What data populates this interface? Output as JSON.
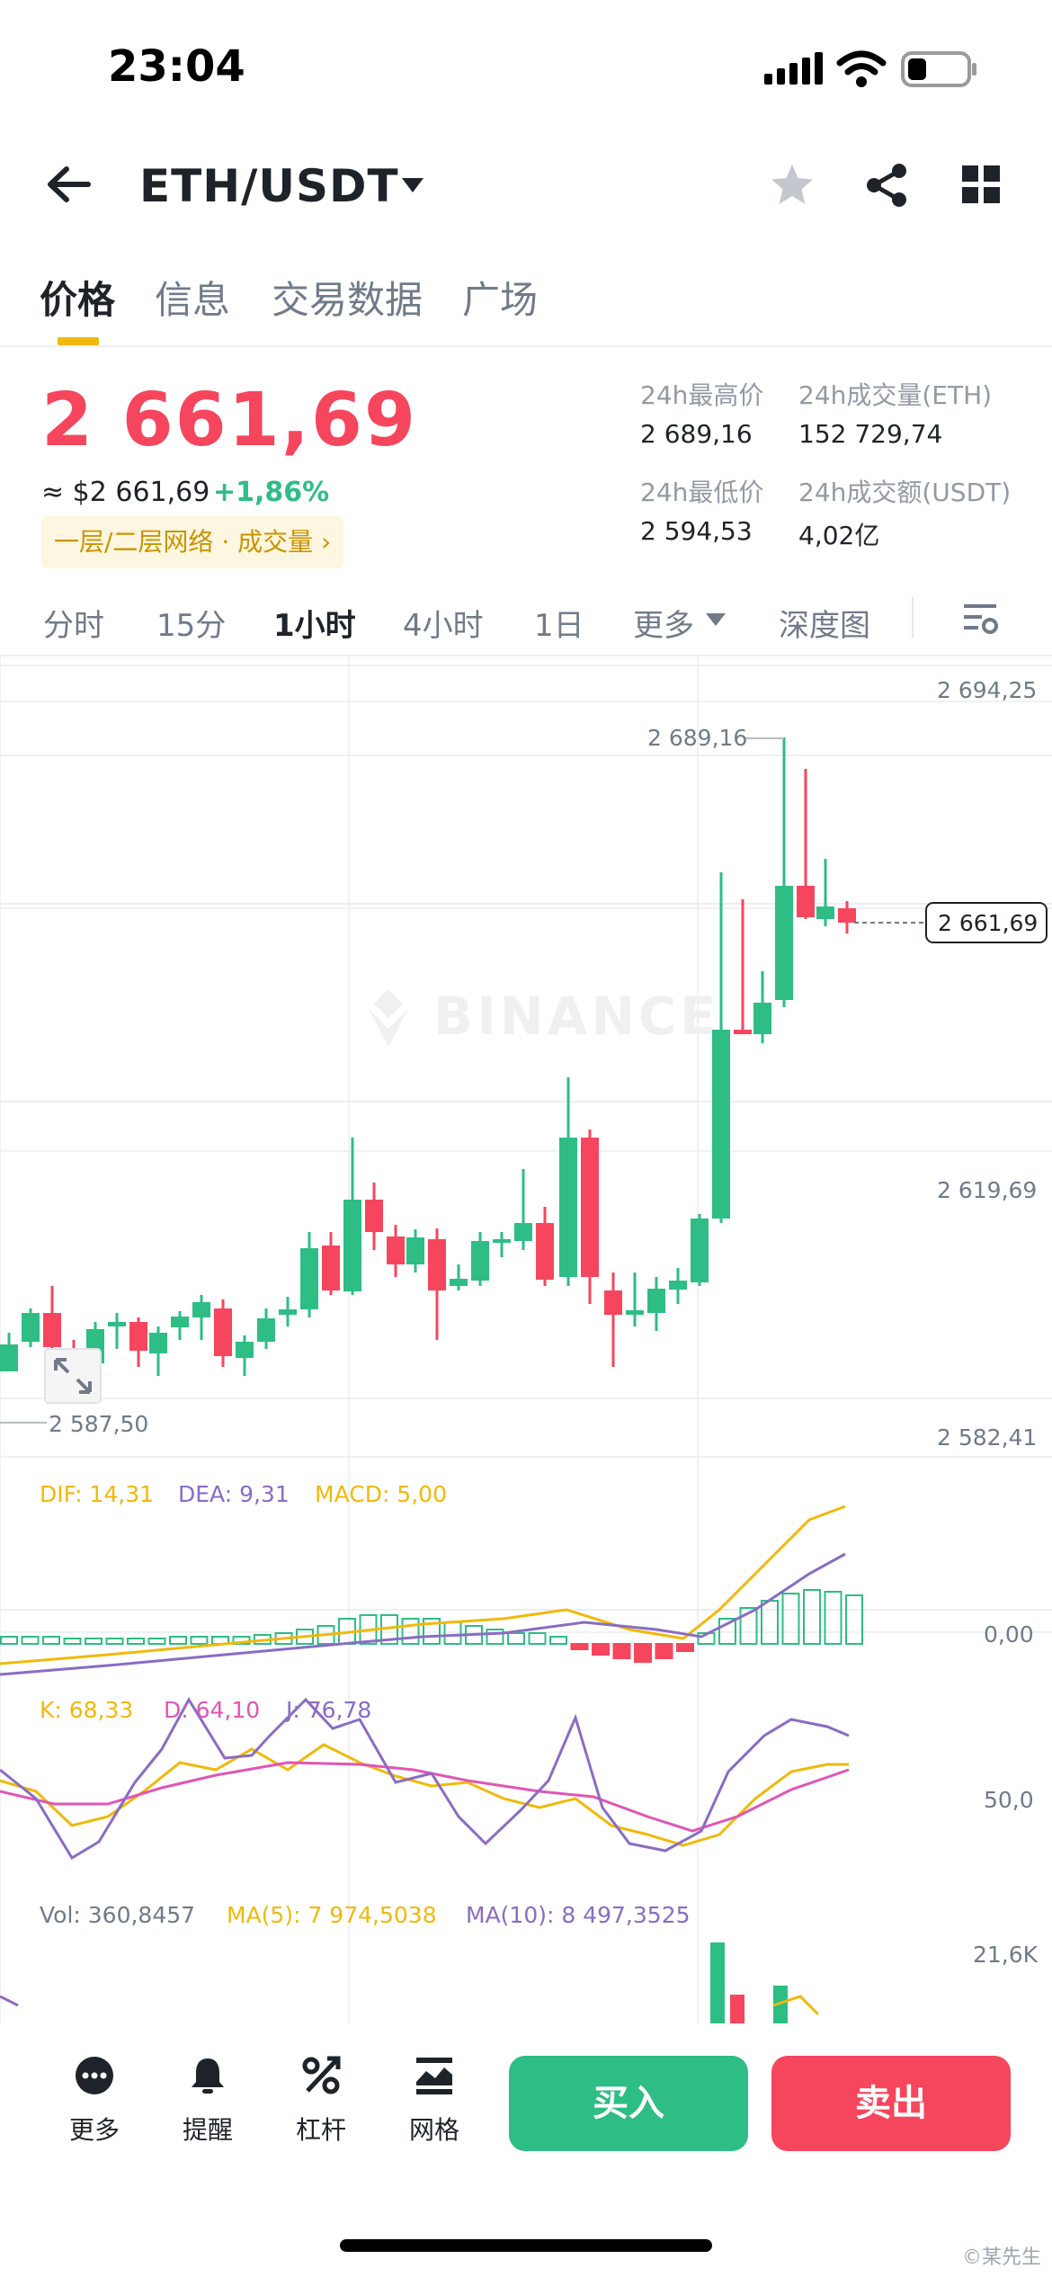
{
  "status_bar": {
    "time": "23:04"
  },
  "header": {
    "pair": "ETH/USDT"
  },
  "tabs": [
    {
      "label": "价格"
    },
    {
      "label": "信息"
    },
    {
      "label": "交易数据"
    },
    {
      "label": "广场"
    }
  ],
  "price": {
    "last": "2 661,69",
    "approx": "≈ $2 661,69",
    "change": "+1,86%",
    "chip": "一层/二层网络 · 成交量 ›"
  },
  "stats": {
    "high_label": "24h最高价",
    "high": "2 689,16",
    "vol_eth_label": "24h成交量(ETH)",
    "vol_eth": "152 729,74",
    "low_label": "24h最低价",
    "low": "2 594,53",
    "vol_usdt_label": "24h成交额(USDT)",
    "vol_usdt": "4,02亿"
  },
  "intervals": {
    "items": [
      "分时",
      "15分",
      "1小时",
      "4小时",
      "1日",
      "更多",
      "深度图"
    ],
    "selected": "1小时"
  },
  "chart": {
    "watermark": "BINANCE",
    "y_labels": [
      "2 694,25",
      "2 619,69",
      "2 582,41"
    ],
    "current_price_tag": "2 661,69",
    "high_marker": "2 689,16",
    "low_marker": "2 587,50",
    "macd_legend": {
      "dif": "DIF: 14,31",
      "dea": "DEA: 9,31",
      "macd": "MACD: 5,00"
    },
    "macd_zero": "0,00",
    "kdj_legend": {
      "k": "K: 68,33",
      "d": "D: 64,10",
      "j": "J: 76,78"
    },
    "kdj_mid": "50,0",
    "vol_legend": {
      "vol": "Vol: 360,8457",
      "ma5": "MA(5): 7 974,5038",
      "ma10": "MA(10): 8 497,3525"
    },
    "vol_max": "21,6K",
    "colors": {
      "up": "#2ebd85",
      "down": "#f6465d",
      "dif": "#f0b90b",
      "dea": "#8a6cc4",
      "k": "#f0b90b",
      "d": "#e056b5",
      "j": "#8a6cc4"
    }
  },
  "bottom_bar": {
    "tools": [
      {
        "label": "更多",
        "icon": "more-icon"
      },
      {
        "label": "提醒",
        "icon": "bell-icon"
      },
      {
        "label": "杠杆",
        "icon": "leverage-icon"
      },
      {
        "label": "网格",
        "icon": "grid-bot-icon"
      }
    ],
    "buy": "买入",
    "sell": "卖出"
  },
  "watermark": "©某先生"
}
